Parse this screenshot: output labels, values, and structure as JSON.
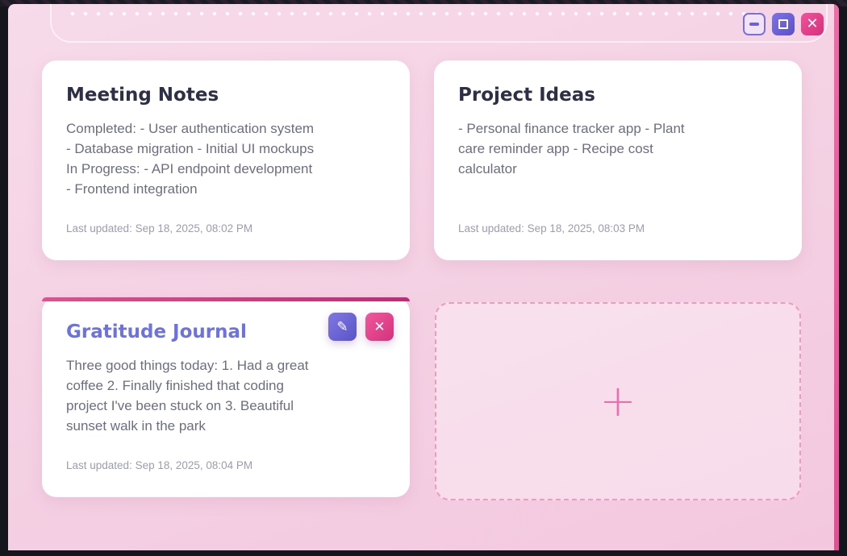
{
  "window_controls": {
    "minimize_icon": "minimize-icon",
    "maximize_icon": "maximize-icon",
    "close_icon": "close-icon"
  },
  "notes": [
    {
      "title": "Meeting Notes",
      "body": "Completed: - User authentication system - Database migration - Initial UI mockups In Progress: - API endpoint development - Frontend integration",
      "updated": "Last updated: Sep 18, 2025, 08:02 PM"
    },
    {
      "title": "Project Ideas",
      "body": "- Personal finance tracker app - Plant care reminder app - Recipe cost calculator",
      "updated": "Last updated: Sep 18, 2025, 08:03 PM"
    },
    {
      "title": "Gratitude Journal",
      "body": "Three good things today: 1. Had a great coffee 2. Finally finished that coding project I've been stuck on 3. Beautiful sunset walk in the park",
      "updated": "Last updated: Sep 18, 2025, 08:04 PM"
    }
  ],
  "add_note": {
    "glyph": "+"
  },
  "colors": {
    "accent_pink": "#e34e94",
    "accent_purple": "#6c72df",
    "background": "#f4d0e3"
  }
}
